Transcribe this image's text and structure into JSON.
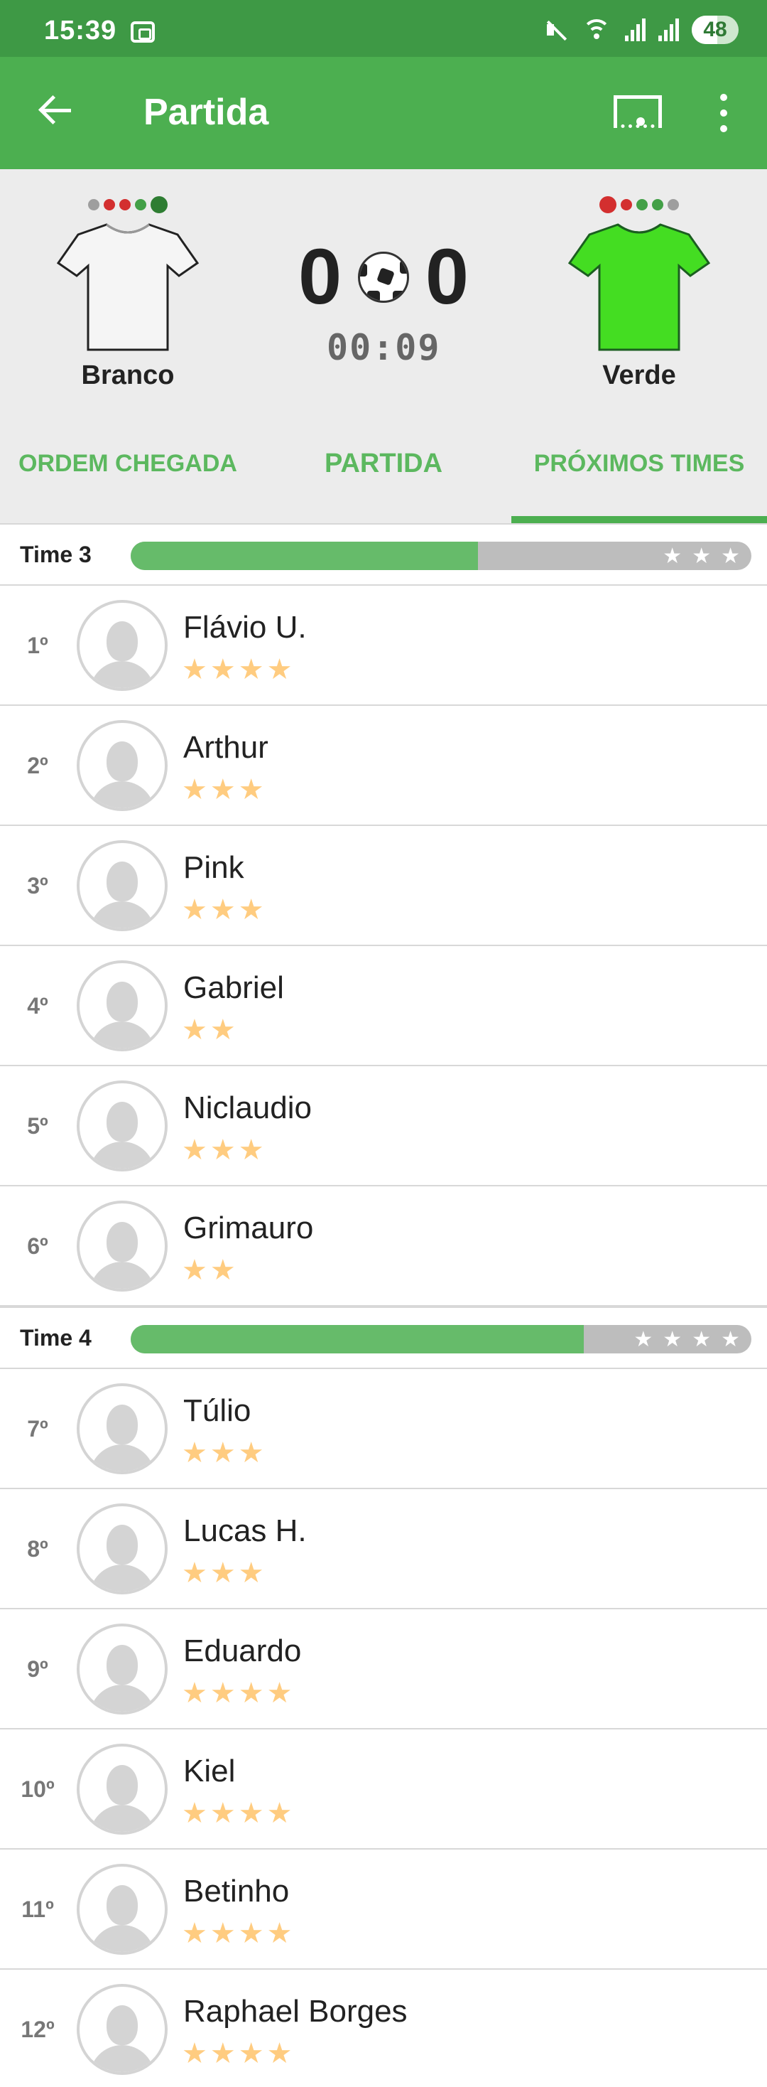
{
  "status_bar": {
    "time": "15:39",
    "battery": "48"
  },
  "app_bar": {
    "title": "Partida"
  },
  "match": {
    "home": {
      "name": "Branco",
      "shirt_color": "#f5f5f5",
      "form": [
        "#9e9e9e",
        "#d32f2f",
        "#d32f2f",
        "#43a047",
        "#2e7d32"
      ]
    },
    "away": {
      "name": "Verde",
      "shirt_color": "#44dd22",
      "form": [
        "#d32f2f",
        "#d32f2f",
        "#43a047",
        "#43a047",
        "#9e9e9e"
      ]
    },
    "home_score": "0",
    "away_score": "0",
    "clock": "00:09"
  },
  "tabs": [
    {
      "label": "ORDEM CHEGADA",
      "active": false
    },
    {
      "label": "PARTIDA",
      "active": false
    },
    {
      "label": "PRÓXIMOS TIMES",
      "active": true
    }
  ],
  "groups": [
    {
      "label": "Time 3",
      "progress": 0.56,
      "bar_stars": 3,
      "players": [
        {
          "pos": "1º",
          "name": "Flávio U.",
          "stars": 4
        },
        {
          "pos": "2º",
          "name": "Arthur",
          "stars": 3
        },
        {
          "pos": "3º",
          "name": "Pink",
          "stars": 3
        },
        {
          "pos": "4º",
          "name": "Gabriel",
          "stars": 2
        },
        {
          "pos": "5º",
          "name": "Niclaudio",
          "stars": 3
        },
        {
          "pos": "6º",
          "name": "Grimauro",
          "stars": 2
        }
      ]
    },
    {
      "label": "Time 4",
      "progress": 0.73,
      "bar_stars": 4,
      "players": [
        {
          "pos": "7º",
          "name": "Túlio",
          "stars": 3
        },
        {
          "pos": "8º",
          "name": "Lucas H.",
          "stars": 3
        },
        {
          "pos": "9º",
          "name": "Eduardo",
          "stars": 4
        },
        {
          "pos": "10º",
          "name": "Kiel",
          "stars": 4
        },
        {
          "pos": "11º",
          "name": "Betinho",
          "stars": 4
        },
        {
          "pos": "12º",
          "name": "Raphael Borges",
          "stars": 4
        }
      ]
    }
  ]
}
